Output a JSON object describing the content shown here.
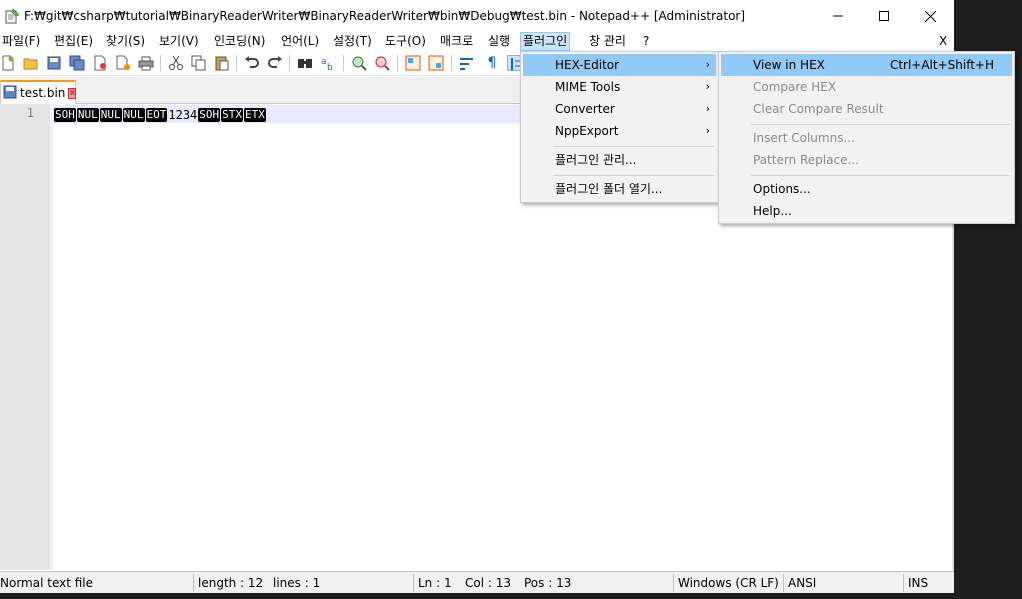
{
  "window": {
    "title": "F:₩git₩csharp₩tutorial₩BinaryReaderWriter₩BinaryReaderWriter₩bin₩Debug₩test.bin - Notepad++ [Administrator]",
    "min_icon": "minimize-icon",
    "max_icon": "maximize-icon",
    "close_icon": "close-icon"
  },
  "menubar": {
    "items": [
      {
        "label": "파일(F)"
      },
      {
        "label": "편집(E)"
      },
      {
        "label": "찾기(S)"
      },
      {
        "label": "보기(V)"
      },
      {
        "label": "인코딩(N)"
      },
      {
        "label": "언어(L)"
      },
      {
        "label": "설정(T)"
      },
      {
        "label": "도구(O)"
      },
      {
        "label": "매크로"
      },
      {
        "label": "실행"
      },
      {
        "label": "플러그인"
      },
      {
        "label": "창 관리"
      },
      {
        "label": "?"
      }
    ],
    "close_doc": "X"
  },
  "tab": {
    "label": "test.bin",
    "close_symbol": "x"
  },
  "editor": {
    "line_number": "1",
    "tokens": [
      {
        "kind": "ctrl",
        "text": "SOH"
      },
      {
        "kind": "ctrl",
        "text": "NUL"
      },
      {
        "kind": "ctrl",
        "text": "NUL"
      },
      {
        "kind": "ctrl",
        "text": "NUL"
      },
      {
        "kind": "ctrl",
        "text": "EOT"
      },
      {
        "kind": "text",
        "text": "1234"
      },
      {
        "kind": "ctrl",
        "text": "SOH"
      },
      {
        "kind": "ctrl",
        "text": "STX"
      },
      {
        "kind": "ctrl",
        "text": "ETX"
      }
    ]
  },
  "statusbar": {
    "file_type": "Normal text file",
    "length": "length : 12",
    "lines": "lines : 1",
    "ln": "Ln : 1",
    "col": "Col : 13",
    "pos": "Pos : 13",
    "eol": "Windows (CR LF)",
    "encoding": "ANSI",
    "mode": "INS"
  },
  "plugin_menu": {
    "items": [
      {
        "label": "HEX-Editor",
        "submenu": true,
        "highlighted": true
      },
      {
        "label": "MIME Tools",
        "submenu": true
      },
      {
        "label": "Converter",
        "submenu": true
      },
      {
        "label": "NppExport",
        "submenu": true
      },
      {
        "label": "플러그인 관리..."
      },
      {
        "label": "플러그인 폴더 열기..."
      }
    ]
  },
  "hex_menu": {
    "items": [
      {
        "label": "View in HEX",
        "shortcut": "Ctrl+Alt+Shift+H",
        "highlighted": true
      },
      {
        "label": "Compare HEX",
        "disabled": true
      },
      {
        "label": "Clear Compare Result",
        "disabled": true
      },
      {
        "label": "Insert Columns...",
        "disabled": true
      },
      {
        "label": "Pattern Replace...",
        "disabled": true
      },
      {
        "label": "Options..."
      },
      {
        "label": "Help..."
      }
    ]
  },
  "colors": {
    "accent_tab": "#f39c12",
    "menu_highlight": "#91c9f7",
    "current_line": "#e8e8ff"
  }
}
